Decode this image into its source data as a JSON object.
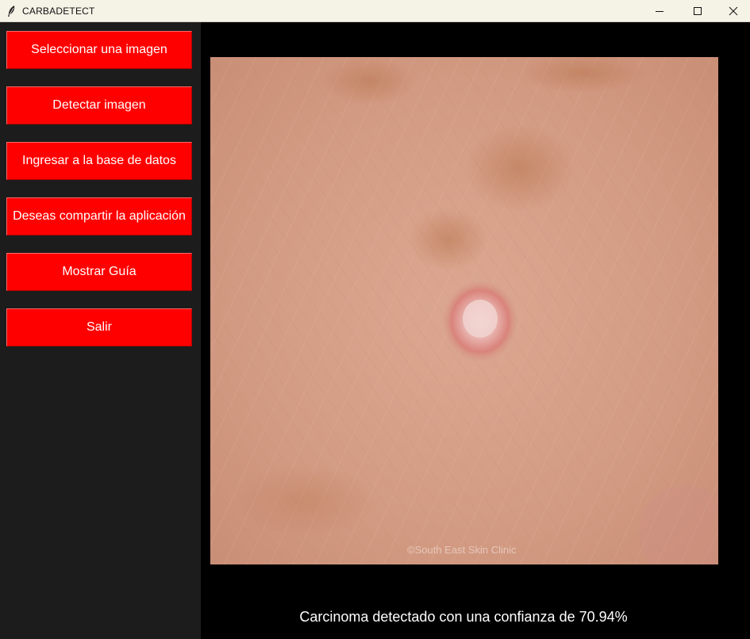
{
  "window": {
    "title": "CARBADETECT",
    "icons": {
      "app": "feather-icon",
      "minimize": "minimize-icon",
      "maximize": "maximize-icon",
      "close": "close-icon"
    }
  },
  "sidebar": {
    "background": "#1c1c1c",
    "button_color": "#ff0000",
    "buttons": [
      {
        "label": "Seleccionar una imagen"
      },
      {
        "label": "Detectar imagen"
      },
      {
        "label": "Ingresar a la base de datos"
      },
      {
        "label": "Deseas compartir la aplicación"
      },
      {
        "label": "Mostrar Guía"
      },
      {
        "label": "Salir"
      }
    ]
  },
  "main": {
    "image": {
      "description_icon": "skin-lesion-photo",
      "watermark": "©South East Skin Clinic"
    },
    "result": "Carcinoma detectado con una confianza de 70.94%"
  }
}
